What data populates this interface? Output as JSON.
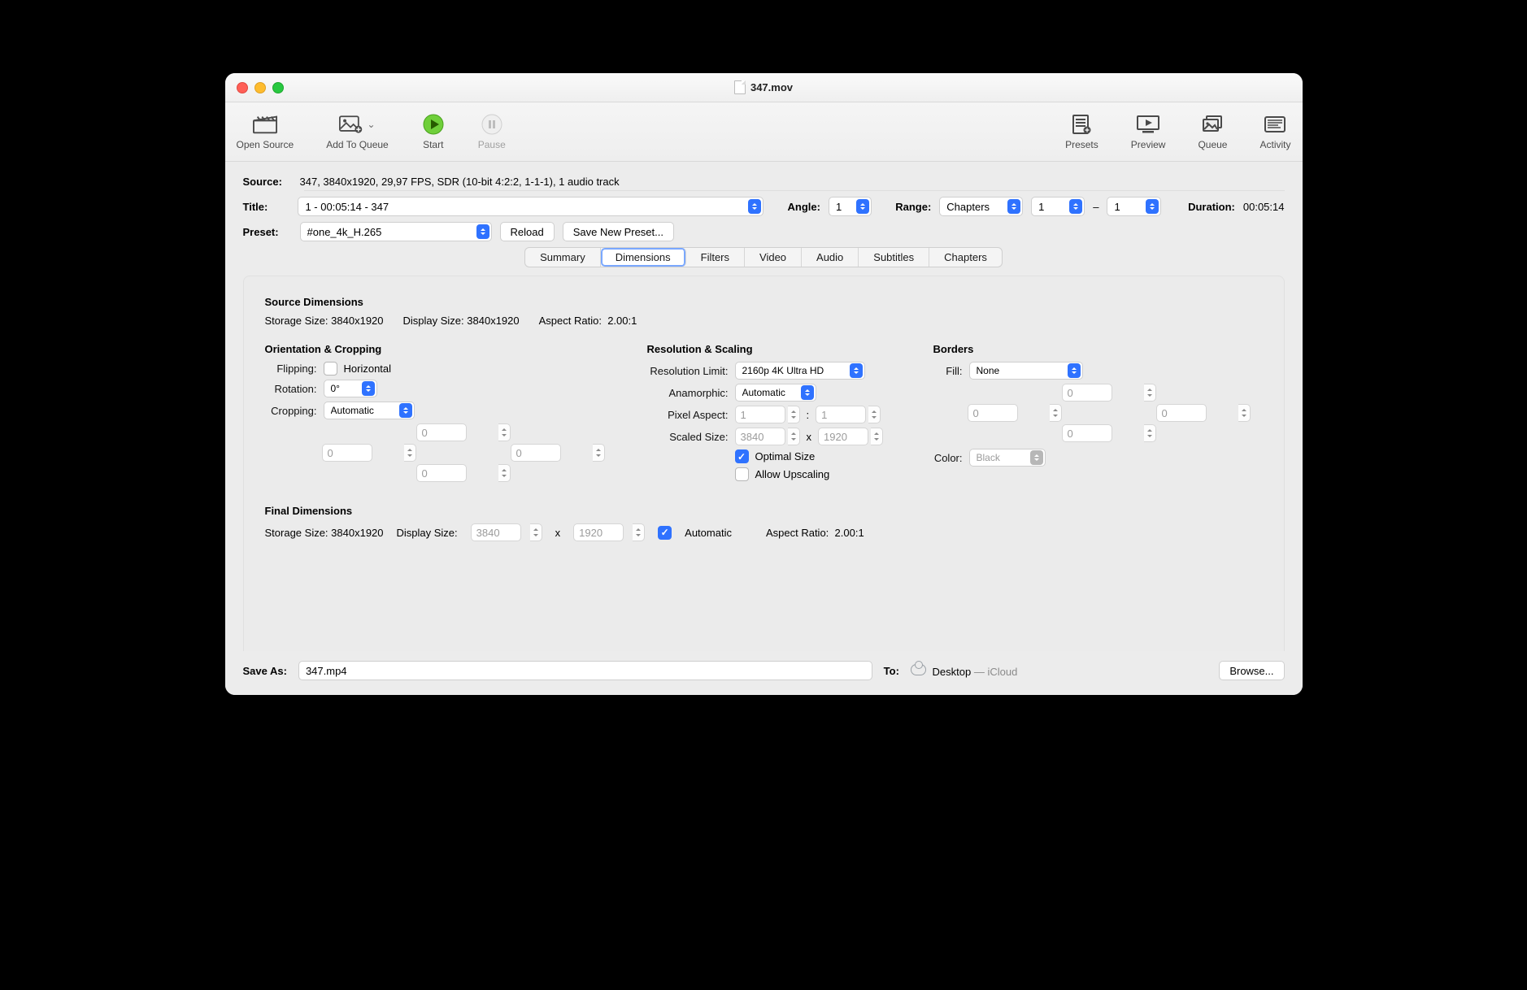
{
  "window": {
    "title": "347.mov"
  },
  "toolbar": {
    "open_source": "Open Source",
    "add_to_queue": "Add To Queue",
    "start": "Start",
    "pause": "Pause",
    "presets": "Presets",
    "preview": "Preview",
    "queue": "Queue",
    "activity": "Activity"
  },
  "source": {
    "label": "Source:",
    "value": "347, 3840x1920, 29,97 FPS, SDR (10-bit 4:2:2, 1-1-1), 1 audio track"
  },
  "title": {
    "label": "Title:",
    "value": "1 - 00:05:14 - 347"
  },
  "angle": {
    "label": "Angle:",
    "value": "1"
  },
  "range": {
    "label": "Range:",
    "type": "Chapters",
    "from": "1",
    "to": "1",
    "dash": "–"
  },
  "duration": {
    "label": "Duration:",
    "value": "00:05:14"
  },
  "preset": {
    "label": "Preset:",
    "value": "#one_4k_H.265",
    "reload": "Reload",
    "save_new": "Save New Preset..."
  },
  "tabs": [
    "Summary",
    "Dimensions",
    "Filters",
    "Video",
    "Audio",
    "Subtitles",
    "Chapters"
  ],
  "active_tab": "Dimensions",
  "source_dim": {
    "heading": "Source Dimensions",
    "storage_lbl": "Storage Size:",
    "storage": "3840x1920",
    "display_lbl": "Display Size:",
    "display": "3840x1920",
    "aspect_lbl": "Aspect Ratio:",
    "aspect": "2.00:1"
  },
  "orient": {
    "heading": "Orientation & Cropping",
    "flip_lbl": "Flipping:",
    "flip_opt": "Horizontal",
    "rot_lbl": "Rotation:",
    "rot_val": "0°",
    "crop_lbl": "Cropping:",
    "crop_mode": "Automatic",
    "crop_top": "0",
    "crop_left": "0",
    "crop_right": "0",
    "crop_bottom": "0"
  },
  "scaling": {
    "heading": "Resolution & Scaling",
    "reslimit_lbl": "Resolution Limit:",
    "reslimit": "2160p 4K Ultra HD",
    "anam_lbl": "Anamorphic:",
    "anam": "Automatic",
    "pix_lbl": "Pixel Aspect:",
    "pix_a": "1",
    "pix_b": "1",
    "colon": ":",
    "scaled_lbl": "Scaled Size:",
    "scaled_w": "3840",
    "scaled_h": "1920",
    "x": "x",
    "opt": "Optimal Size",
    "up": "Allow Upscaling"
  },
  "borders": {
    "heading": "Borders",
    "fill_lbl": "Fill:",
    "fill": "None",
    "top": "0",
    "left": "0",
    "right": "0",
    "bottom": "0",
    "color_lbl": "Color:",
    "color": "Black"
  },
  "final": {
    "heading": "Final Dimensions",
    "storage_lbl": "Storage Size:",
    "storage": "3840x1920",
    "display_lbl": "Display Size:",
    "display_w": "3840",
    "display_h": "1920",
    "x": "x",
    "auto": "Automatic",
    "aspect_lbl": "Aspect Ratio:",
    "aspect": "2.00:1"
  },
  "footer": {
    "save_as_lbl": "Save As:",
    "save_as": "347.mp4",
    "to_lbl": "To:",
    "dest": "Desktop",
    "dest2": " — iCloud",
    "browse": "Browse..."
  }
}
